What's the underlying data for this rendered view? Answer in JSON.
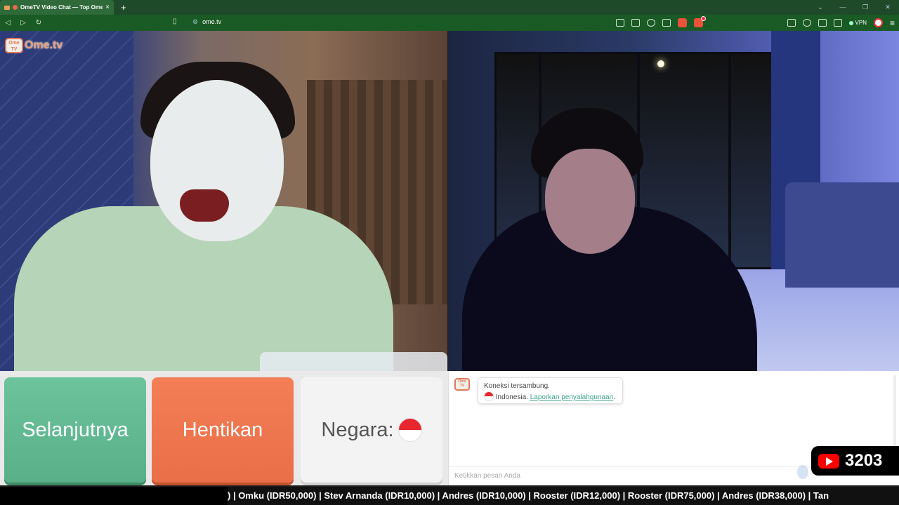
{
  "browser": {
    "tab_title": "OmeTV Video Chat — Top Ome",
    "tab_close": "×",
    "new_tab": "+",
    "url": "ome.tv",
    "vpn_label": "VPN"
  },
  "logo": {
    "icon_text": "Ome TV",
    "text": "Ome.tv"
  },
  "controls": {
    "next_label": "Selanjutnya",
    "stop_label": "Hentikan",
    "country_label": "Negara:"
  },
  "chat": {
    "icon_text": "Ome TV",
    "connected": "Koneksi tersambung.",
    "country": "Indonesia.",
    "report_link": "Laporkan penyalahgunaan",
    "report_suffix": ".",
    "input_placeholder": "Ketikkan pesan Anda"
  },
  "youtube_count": "3203",
  "ticker_text": ") | Omku (IDR50,000) | Stev Arnanda (IDR10,000) | Andres (IDR10,000) | Rooster (IDR12,000) | Rooster (IDR75,000) | Andres (IDR38,000) | Tan",
  "colors": {
    "next_button": "#5fb98f",
    "stop_button": "#ee7550",
    "link": "#3aa38a",
    "browser_chrome": "#1a5a25"
  }
}
